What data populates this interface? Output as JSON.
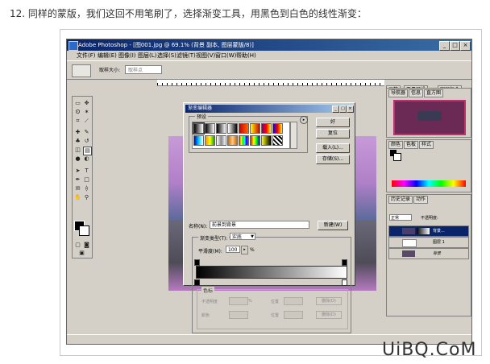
{
  "caption": "12. 同样的蒙版，我们这回不用笔刷了，选择渐变工具，用黑色到白色的线性渐变：",
  "app": {
    "title": "Adobe Photoshop - [图001.jpg @ 69.1% (背景 副本, 图层蒙版/8)]",
    "menu": [
      "文件(F)",
      "编辑(E)",
      "图像(I)",
      "图层(L)",
      "选择(S)",
      "滤镜(T)",
      "视图(V)",
      "窗口(W)",
      "帮助(H)"
    ],
    "options": {
      "label": "取样大小:",
      "value": "取样点"
    },
    "dock_tabs": [
      "画笔",
      "工具预设",
      "图层复合"
    ]
  },
  "gradient_editor": {
    "title": "渐变编辑器",
    "presets_label": "预设",
    "buttons": {
      "ok": "好",
      "reset": "复位",
      "load": "载入(L)...",
      "save": "存储(S)...",
      "new": "新建(W)"
    },
    "name_label": "名称(N):",
    "name_value": "前景到背景",
    "gradient_type_label": "渐变类型(T):",
    "gradient_type_value": "实底",
    "smoothness_label": "平滑度(M):",
    "smoothness_value": "100",
    "smoothness_unit": "%",
    "color_stops_label": "色标",
    "opacity_label": "不透明度",
    "color_label": "颜色",
    "location_label": "位置",
    "delete_label": "删除(D)",
    "colors": {
      "start": "#000000",
      "end": "#ffffff"
    }
  },
  "panels": {
    "navigator_tabs": [
      "导航器",
      "信息",
      "直方图"
    ],
    "color_tabs": [
      "颜色",
      "色板",
      "样式"
    ],
    "layers_tabs": [
      "历史记录",
      "动作"
    ],
    "blend_mode": "正常",
    "opacity_label": "不透明度:",
    "layers": [
      {
        "name": "背景..."
      },
      {
        "name": "图层 1"
      },
      {
        "name": "背景"
      }
    ]
  },
  "watermark": "UiBQ.CoM"
}
